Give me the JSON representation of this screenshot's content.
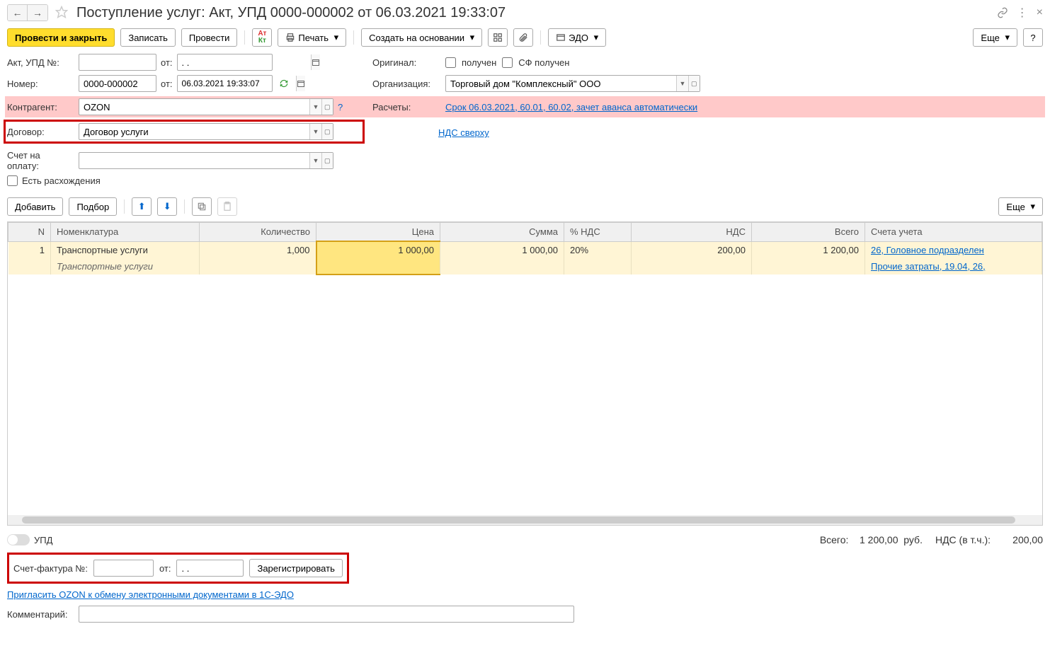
{
  "title": "Поступление услуг: Акт, УПД 0000-000002 от 06.03.2021 19:33:07",
  "toolbar": {
    "post_close": "Провести и закрыть",
    "save": "Записать",
    "post": "Провести",
    "print": "Печать",
    "create_based": "Создать на основании",
    "edo": "ЭДО",
    "more": "Еще"
  },
  "form": {
    "act_label": "Акт, УПД №:",
    "act_value": "",
    "from_label": "от:",
    "act_date": ". .",
    "number_label": "Номер:",
    "number_value": "0000-000002",
    "number_date": "06.03.2021 19:33:07",
    "contractor_label": "Контрагент:",
    "contractor_value": "OZON",
    "contract_label": "Договор:",
    "contract_value": "Договор услуги",
    "invoice_label": "Счет на оплату:",
    "invoice_value": "",
    "discrepancy_label": "Есть расхождения",
    "original_label": "Оригинал:",
    "received_label": "получен",
    "sf_received_label": "СФ получен",
    "org_label": "Организация:",
    "org_value": "Торговый дом \"Комплексный\" ООО",
    "settle_label": "Расчеты:",
    "settle_link": "Срок 06.03.2021, 60.01, 60.02, зачет аванса автоматически",
    "vat_link": "НДС сверху"
  },
  "tbl_toolbar": {
    "add": "Добавить",
    "select": "Подбор",
    "more": "Еще"
  },
  "columns": {
    "n": "N",
    "nom": "Номенклатура",
    "qty": "Количество",
    "price": "Цена",
    "sum": "Сумма",
    "vat_rate": "% НДС",
    "vat": "НДС",
    "total": "Всего",
    "acc": "Счета учета"
  },
  "row": {
    "n": "1",
    "nom": "Транспортные услуги",
    "nom_sub": "Транспортные услуги",
    "qty": "1,000",
    "price": "1 000,00",
    "sum": "1 000,00",
    "vat_rate": "20%",
    "vat": "200,00",
    "total": "1 200,00",
    "acc1": "26, Головное подразделен",
    "acc2": "Прочие затраты, 19.04, 26,"
  },
  "footer": {
    "upd_label": "УПД",
    "total_label": "Всего:",
    "total_value": "1 200,00",
    "currency": "руб.",
    "vat_incl_label": "НДС (в т.ч.):",
    "vat_incl_value": "200,00",
    "sf_label": "Счет-фактура №:",
    "sf_from": "от:",
    "sf_date": ". .",
    "register": "Зарегистрировать",
    "invite_link": "Пригласить OZON к обмену электронными документами в 1С-ЭДО",
    "comment_label": "Комментарий:"
  }
}
